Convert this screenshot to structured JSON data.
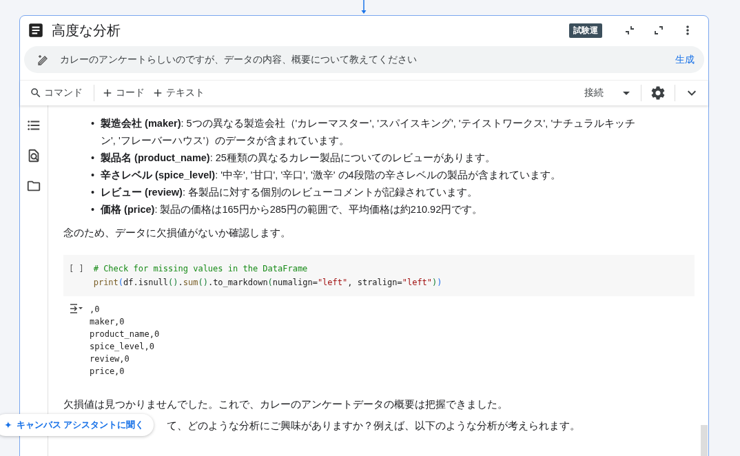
{
  "notebook": {
    "title": "高度な分析",
    "badge": "試験運"
  },
  "prompt": {
    "text": "カレーのアンケートらしいのですが、データの内容、概要について教えてください",
    "action": "生成"
  },
  "toolbar": {
    "command": "コマンド",
    "add_code": "コード",
    "add_text": "テキスト",
    "connect": "接続"
  },
  "bullets": [
    "**製造会社 (maker)**: 5つの異なる製造会社（'カレーマスター', 'スパイスキング', 'テイストワークス', 'ナチュラルキッチン', 'フレーバーハウス'）のデータが含まれています。",
    "**製品名 (product_name)**: 25種類の異なるカレー製品についてのレビューがあります。",
    "**辛さレベル (spice_level)**: '中辛', '甘口', '辛口', '激辛' の4段階の辛さレベルの製品が含まれています。",
    "**レビュー (review)**: 各製品に対する個別のレビューコメントが記録されています。",
    "**価格 (price)**: 製品の価格は165円から285円の範囲で、平均価格は約210.92円です。"
  ],
  "note": "念のため、データに欠損値がないか確認します。",
  "code_cell": {
    "run_label": "[ ]",
    "lines": [
      [
        {
          "kind": "comment",
          "text": "# Check for missing values in the DataFrame"
        }
      ],
      [
        {
          "kind": "builtin",
          "text": "print"
        },
        {
          "kind": "paren",
          "text": "("
        },
        {
          "kind": "plain",
          "text": "df.isnull"
        },
        {
          "kind": "paren2",
          "text": "()"
        },
        {
          "kind": "plain",
          "text": "."
        },
        {
          "kind": "builtin",
          "text": "sum"
        },
        {
          "kind": "paren2",
          "text": "()"
        },
        {
          "kind": "plain",
          "text": ".to_markdown"
        },
        {
          "kind": "paren2",
          "text": "("
        },
        {
          "kind": "plain",
          "text": "numalign="
        },
        {
          "kind": "string",
          "text": "\"left\""
        },
        {
          "kind": "plain",
          "text": ", stralign="
        },
        {
          "kind": "string",
          "text": "\"left\""
        },
        {
          "kind": "paren2",
          "text": ")"
        },
        {
          "kind": "paren",
          "text": ")"
        }
      ]
    ],
    "output": [
      ",0",
      "maker,0",
      "product_name,0",
      "spice_level,0",
      "review,0",
      "price,0"
    ]
  },
  "conclusion": "欠損値は見つかりませんでした。これで、カレーのアンケートデータの概要は把握できました。",
  "question": "て、どのような分析にご興味がありますか？例えば、以下のような分析が考えられます。",
  "assistant_button": {
    "icon": "✦",
    "label": "キャンバス アシスタントに聞く"
  },
  "bullet_marker": "•"
}
